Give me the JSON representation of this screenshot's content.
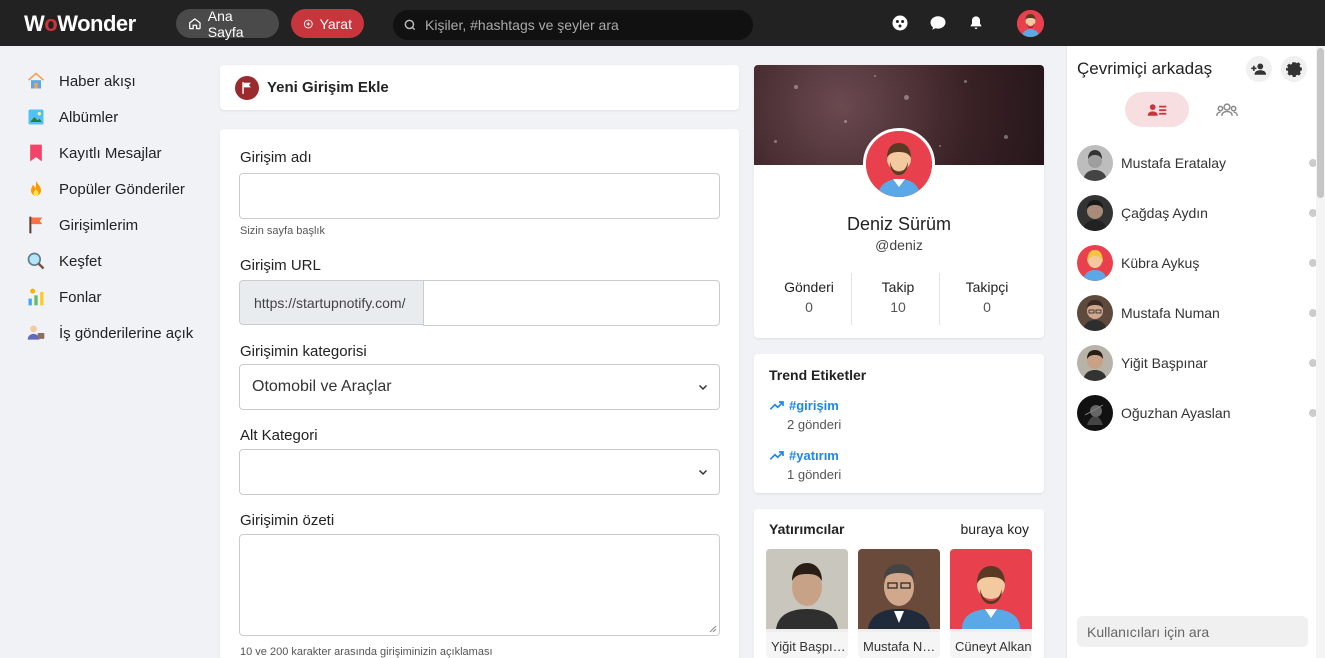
{
  "topbar": {
    "logo_text": "WoWonder",
    "home_label": "Ana Sayfa",
    "create_label": "Yarat",
    "search_placeholder": "Kişiler, #hashtags ve şeyler ara"
  },
  "leftnav": {
    "items": [
      {
        "label": "Haber akışı",
        "icon": "home-icon"
      },
      {
        "label": "Albümler",
        "icon": "album-icon"
      },
      {
        "label": "Kayıtlı Mesajlar",
        "icon": "bookmark-icon"
      },
      {
        "label": "Popüler Gönderiler",
        "icon": "fire-icon"
      },
      {
        "label": "Girişimlerim",
        "icon": "flag-icon"
      },
      {
        "label": "Keşfet",
        "icon": "explore-icon"
      },
      {
        "label": "Fonlar",
        "icon": "funds-icon"
      },
      {
        "label": "İş gönderilerine açık",
        "icon": "jobs-icon"
      }
    ]
  },
  "form": {
    "header": "Yeni Girişim Ekle",
    "name_label": "Girişim adı",
    "name_value": "",
    "name_hint": "Sizin sayfa başlık",
    "url_label": "Girişim URL",
    "url_prefix": "https://startupnotify.com/",
    "url_value": "",
    "category_label": "Girişimin kategorisi",
    "category_value": "Otomobil ve Araçlar",
    "subcategory_label": "Alt Kategori",
    "subcategory_value": "",
    "summary_label": "Girişimin özeti",
    "summary_value": "",
    "summary_hint": "10 ve 200 karakter arasında girişiminizin açıklaması"
  },
  "profile": {
    "name": "Deniz Sürüm",
    "username": "@deniz",
    "stats": [
      {
        "label": "Gönderi",
        "value": "0"
      },
      {
        "label": "Takip",
        "value": "10"
      },
      {
        "label": "Takipçi",
        "value": "0"
      }
    ]
  },
  "trends": {
    "title": "Trend Etiketler",
    "items": [
      {
        "tag": "#girişim",
        "count": "2 gönderi"
      },
      {
        "tag": "#yatırım",
        "count": "1 gönderi"
      }
    ]
  },
  "investors": {
    "title": "Yatırımcılar",
    "link": "buraya koy",
    "items": [
      {
        "name": "Yiğit Başpınar"
      },
      {
        "name": "Mustafa Numan"
      },
      {
        "name": "Cüneyt Alkan"
      }
    ]
  },
  "rightbar": {
    "title": "Çevrimiçi arkadaş",
    "friends": [
      {
        "name": "Mustafa Eratalay"
      },
      {
        "name": "Çağdaş Aydın"
      },
      {
        "name": "Kübra Aykuş"
      },
      {
        "name": "Mustafa Numan"
      },
      {
        "name": "Yiğit Başpınar"
      },
      {
        "name": "Oğuzhan Ayaslan"
      }
    ],
    "search_placeholder": "Kullanıcıları için ara"
  },
  "colors": {
    "accent": "#c9353d",
    "topbar": "#222222",
    "link": "#1e88e5"
  }
}
